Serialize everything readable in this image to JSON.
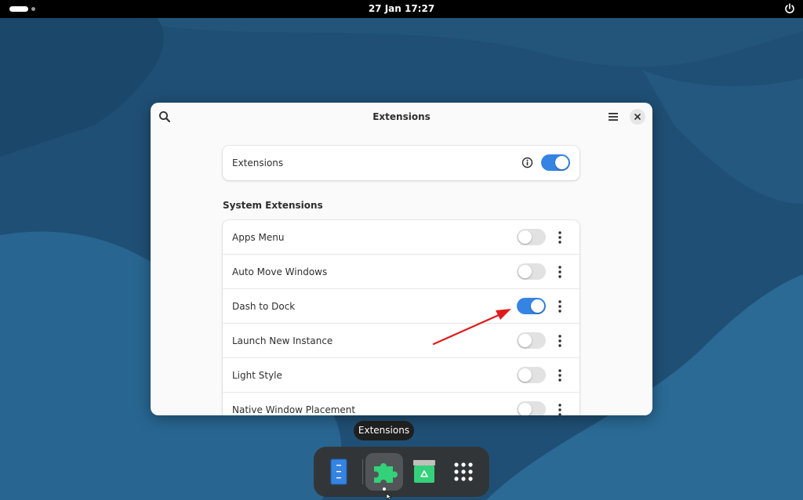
{
  "topbar": {
    "clock": "27 Jan  17:27",
    "icons": {
      "power": "power-icon"
    }
  },
  "window": {
    "title": "Extensions",
    "icons": {
      "search": "search-icon",
      "menu": "hamburger-menu-icon",
      "close": "close-icon"
    },
    "master": {
      "label": "Extensions",
      "enabled": true,
      "info_icon": "info-icon"
    },
    "section_title": "System Extensions",
    "extensions": [
      {
        "name": "Apps Menu",
        "enabled": false
      },
      {
        "name": "Auto Move Windows",
        "enabled": false
      },
      {
        "name": "Dash to Dock",
        "enabled": true
      },
      {
        "name": "Launch New Instance",
        "enabled": false
      },
      {
        "name": "Light Style",
        "enabled": false
      },
      {
        "name": "Native Window Placement",
        "enabled": false
      }
    ]
  },
  "tooltip": {
    "text": "Extensions"
  },
  "dock": {
    "apps": [
      {
        "name": "Files",
        "icon": "files-icon"
      },
      {
        "name": "Extensions",
        "icon": "puzzle-icon",
        "active": true
      },
      {
        "name": "Trash",
        "icon": "trash-icon"
      },
      {
        "name": "Show Apps",
        "icon": "app-grid-icon"
      }
    ]
  },
  "colors": {
    "accent": "#3584e4",
    "annotation": "#e01b1b",
    "extensions_app": "#33d17a"
  }
}
